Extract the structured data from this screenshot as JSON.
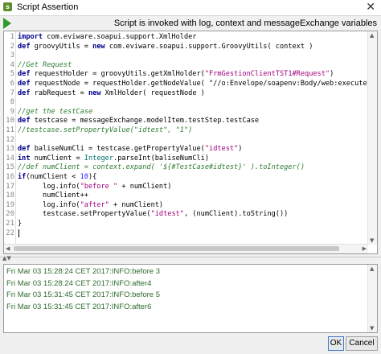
{
  "window": {
    "title": "Script Assertion",
    "close_glyph": "✕"
  },
  "toolbar": {
    "run_icon": "run-icon",
    "info": "Script is invoked with log, context and messageExchange variables"
  },
  "editor": {
    "line_numbers": [
      "1",
      "2",
      "3",
      "4",
      "5",
      "6",
      "7",
      "8",
      "9",
      "10",
      "11",
      "12",
      "13",
      "14",
      "15",
      "16",
      "17",
      "18",
      "19",
      "20",
      "21",
      "22"
    ],
    "lines": [
      "import com.eviware.soapui.support.XmlHolder",
      "def groovyUtils = new com.eviware.soapui.support.GroovyUtils( context )",
      "",
      "//Get Request",
      "def requestHolder = groovyUtils.getXmlHolder(\"FrmGestionClientTST1#Request\")",
      "def requestNode = requestHolder.getNodeValue( \"//o:Envelope/soapenv:Body/web:executeSe",
      "def rabRequest = new XmlHolder( requestNode )",
      "",
      "//get the testCase",
      "def testcase = messageExchange.modelItem.testStep.testCase",
      "//testcase.setPropertyValue(\"idtest\", \"1\")",
      "",
      "def baliseNumCli = testcase.getPropertyValue(\"idtest\")",
      "int numClient = Integer.parseInt(baliseNumCli)",
      "//def numClient = context.expand( '${#TestCase#idtest}' ).toInteger()",
      "if(numClient < 10){",
      "      log.info(\"before \" + numClient)",
      "      numClient++",
      "      log.info(\"after\" + numClient)",
      "      testcase.setPropertyValue(\"idtest\", (numClient).toString())",
      "}",
      ""
    ]
  },
  "log": {
    "lines": [
      "Fri Mar 03 15:28:24 CET 2017:INFO:before 3",
      "Fri Mar 03 15:28:24 CET 2017:INFO:after4",
      "Fri Mar 03 15:31:45 CET 2017:INFO:before 5",
      "Fri Mar 03 15:31:45 CET 2017:INFO:after6"
    ]
  },
  "buttons": {
    "ok": "OK",
    "cancel": "Cancel"
  }
}
